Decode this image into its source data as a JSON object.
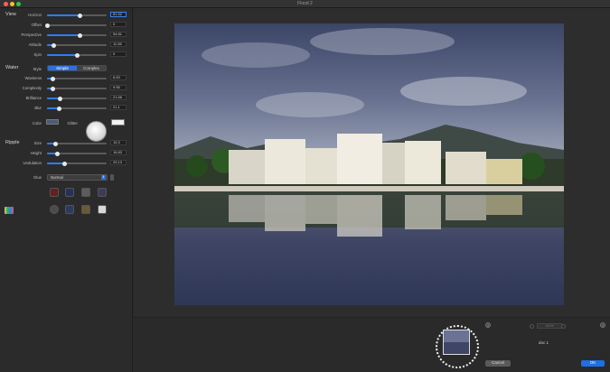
{
  "window": {
    "title": "Flood 2"
  },
  "view": {
    "section_label": "View",
    "params": [
      {
        "label": "Horizon",
        "value": "81.52",
        "fraction": 0.55
      },
      {
        "label": "Offset",
        "value": "0",
        "fraction": 0.0
      },
      {
        "label": "Perspective",
        "value": "54.81",
        "fraction": 0.55
      },
      {
        "label": "Altitude",
        "value": "11.56",
        "fraction": 0.12
      },
      {
        "label": "Spin",
        "value": "0",
        "fraction": 0.5
      }
    ]
  },
  "water": {
    "section_label": "Water",
    "style_label": "Style",
    "style_options": [
      "Simple",
      "Complex"
    ],
    "style_selected": "Simple",
    "params": [
      {
        "label": "Waviness",
        "value": "6.63",
        "fraction": 0.1
      },
      {
        "label": "Complexity",
        "value": "9.55",
        "fraction": 0.1
      },
      {
        "label": "Brilliance",
        "value": "21.66",
        "fraction": 0.22
      },
      {
        "label": "Blur",
        "value": "21.1",
        "fraction": 0.21
      }
    ],
    "color_label": "Color",
    "glitter_label": "Glitter",
    "color_value": "#4a5a7a",
    "glitter_color": "#f2f2f2"
  },
  "ripple": {
    "section_label": "Ripple",
    "params": [
      {
        "label": "Size",
        "value": "15.3",
        "fraction": 0.15
      },
      {
        "label": "Height",
        "value": "16.83",
        "fraction": 0.17
      },
      {
        "label": "Undulation",
        "value": "29.13",
        "fraction": 0.29
      }
    ]
  },
  "glue": {
    "label": "Glue",
    "selected": "Normal"
  },
  "bottom": {
    "zoom": "100%",
    "doc_name": "doc 1",
    "cancel_label": "Cancel",
    "ok_label": "OK",
    "help_glyph": "?"
  },
  "colors": {
    "accent": "#2e6fd9",
    "ok_button": "#1f6fe5"
  }
}
